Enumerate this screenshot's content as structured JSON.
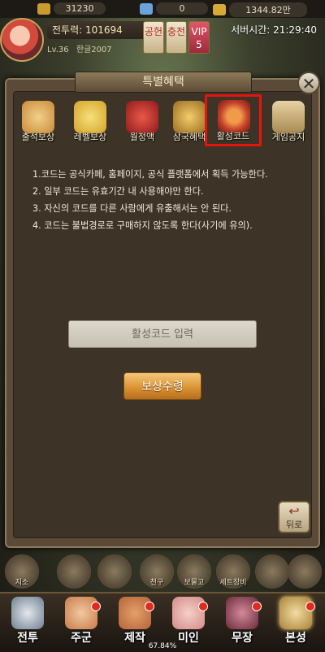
{
  "resources": [
    {
      "name": "gold-ingot",
      "value": "31230",
      "color": "#c99a2e"
    },
    {
      "name": "gem",
      "value": "0",
      "color": "#6aa3d9"
    },
    {
      "name": "coins",
      "value": "1344.82만",
      "color": "#d6a93a"
    }
  ],
  "player": {
    "power_label": "전투력:",
    "power": "101694",
    "level": "Lv.36",
    "name": "한글2007"
  },
  "top_buttons": [
    "공헌",
    "충전",
    "VIP 5"
  ],
  "server_time": "서버시간: 21:29:40",
  "modal": {
    "title": "특별혜택",
    "tabs": [
      {
        "label": "출석보상",
        "icon": "scroll-icon",
        "color": "#c98a3a"
      },
      {
        "label": "레벨보상",
        "icon": "gift-box-icon",
        "color": "#d4a32a"
      },
      {
        "label": "월정액",
        "icon": "red-envelope-icon",
        "color": "#c02a2a"
      },
      {
        "label": "삼국혜택",
        "icon": "gold-pot-icon",
        "color": "#d9a33a"
      },
      {
        "label": "활성코드",
        "icon": "pouch-icon",
        "color": "#c5402a"
      },
      {
        "label": "게임공지",
        "icon": "notice-board-icon",
        "color": "#d2b27a"
      }
    ],
    "selected_tab": "활성코드",
    "description": [
      "1.코드는 공식카페, 홈페이지, 공식 플랫폼에서 획득 가능한다.",
      "2. 일부 코드는 유효기간 내 사용해야만 한다.",
      "3. 자신의 코드를 다른 사람에게 유출해서는 안 된다.",
      "4. 코드는 불법경로로 구매하지 않도록 한다(사기에 유의)."
    ],
    "code_input_placeholder": "활성코드 입력",
    "claim_button": "보상수령",
    "back_button": "뒤로"
  },
  "sub_icons": [
    "지소",
    "",
    "",
    "천구",
    "보물고",
    "세트장비",
    "",
    ""
  ],
  "nav": [
    {
      "label": "전투",
      "icon": "crossed-swords-icon",
      "color": "#8fa0b0",
      "dot": false
    },
    {
      "label": "주군",
      "icon": "lord-icon",
      "color": "#c97a4a",
      "dot": true
    },
    {
      "label": "제작",
      "icon": "forge-icon",
      "color": "#b5633a",
      "dot": true
    },
    {
      "label": "미인",
      "icon": "beauty-icon",
      "color": "#d28a8a",
      "dot": true
    },
    {
      "label": "무장",
      "icon": "general-icon",
      "color": "#9a4a5a",
      "dot": true
    },
    {
      "label": "본성",
      "icon": "castle-icon",
      "color": "#c9a55a",
      "dot": true
    }
  ],
  "progress": "67.84%"
}
